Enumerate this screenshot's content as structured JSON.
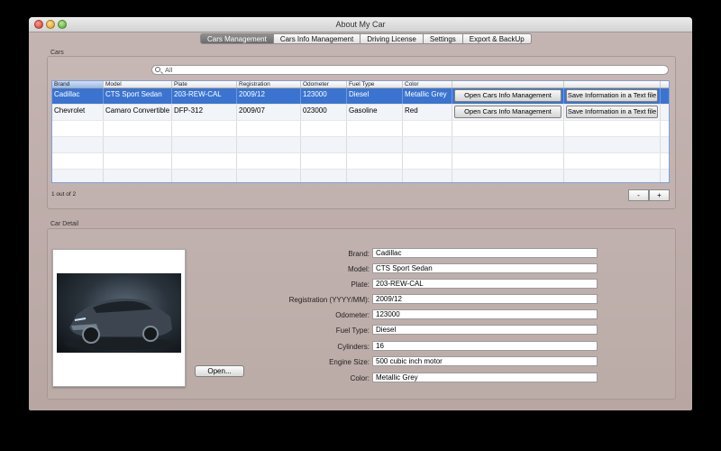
{
  "window": {
    "title": "About My Car"
  },
  "tabs": [
    {
      "label": "Cars Management",
      "active": true
    },
    {
      "label": "Cars Info Management",
      "active": false
    },
    {
      "label": "Driving License",
      "active": false
    },
    {
      "label": "Settings",
      "active": false
    },
    {
      "label": "Export & BackUp",
      "active": false
    }
  ],
  "cars_group": {
    "label": "Cars",
    "search": {
      "placeholder": "All",
      "value": ""
    },
    "columns": [
      "Brand",
      "Model",
      "Plate",
      "Registration",
      "Odometer",
      "Fuel Type",
      "Color",
      "",
      ""
    ],
    "rows": [
      {
        "brand": "Cadillac",
        "model": "CTS Sport Sedan",
        "plate": "203-REW-CAL",
        "registration": "2009/12",
        "odometer": "123000",
        "fuel": "Diesel",
        "color": "Metallic Grey",
        "action1": "Open Cars Info Management",
        "action2": "Save Information in a Text file"
      },
      {
        "brand": "Chevrolet",
        "model": "Camaro Convertible",
        "plate": "DFP-312",
        "registration": "2009/07",
        "odometer": "023000",
        "fuel": "Gasoline",
        "color": "Red",
        "action1": "Open Cars Info Management",
        "action2": "Save Information in a Text file"
      }
    ],
    "status": "1 out of 2",
    "remove_label": "-",
    "add_label": "+"
  },
  "detail": {
    "label": "Car Detail",
    "open_label": "Open...",
    "fields": [
      {
        "label": "Brand:",
        "value": "Cadillac"
      },
      {
        "label": "Model:",
        "value": "CTS Sport Sedan"
      },
      {
        "label": "Plate:",
        "value": "203-REW-CAL"
      },
      {
        "label": "Registration (YYYY/MM):",
        "value": "2009/12"
      },
      {
        "label": "Odometer:",
        "value": "123000"
      },
      {
        "label": "Fuel Type:",
        "value": "Diesel"
      },
      {
        "label": "Cylinders:",
        "value": "16"
      },
      {
        "label": "Engine Size:",
        "value": "500 cubic inch motor"
      },
      {
        "label": "Color:",
        "value": "Metallic Grey"
      }
    ]
  },
  "colors": {
    "selection": "#3b74d0",
    "window_bg": "#bfaeab"
  }
}
